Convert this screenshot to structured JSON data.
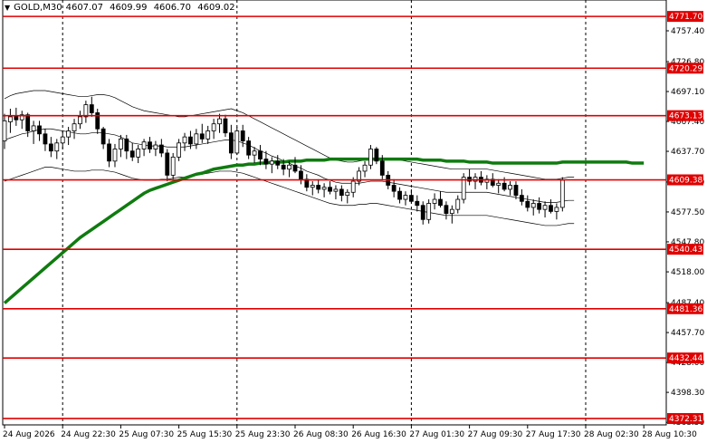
{
  "header": {
    "symbol": "GOLD,M30",
    "open": "4607.07",
    "high": "4609.99",
    "low": "4606.70",
    "close": "4609.02"
  },
  "chart_data": {
    "type": "candlestick",
    "title": "GOLD,M30",
    "ylim": [
      4366.0,
      4788.0
    ],
    "y_ticks": [
      4757.4,
      4726.8,
      4697.1,
      4667.4,
      4637.7,
      4607.2,
      4577.5,
      4547.8,
      4518.0,
      4487.4,
      4457.7,
      4428.0,
      4398.3,
      4368.5
    ],
    "x_ticks": [
      {
        "label": "24 Aug 2026",
        "slot": 0
      },
      {
        "label": "24 Aug 22:30",
        "slot": 10
      },
      {
        "label": "25 Aug 07:30",
        "slot": 20
      },
      {
        "label": "25 Aug 15:30",
        "slot": 30
      },
      {
        "label": "25 Aug 23:30",
        "slot": 40
      },
      {
        "label": "26 Aug 08:30",
        "slot": 50
      },
      {
        "label": "26 Aug 16:30",
        "slot": 60
      },
      {
        "label": "27 Aug 01:30",
        "slot": 70
      },
      {
        "label": "27 Aug 09:30",
        "slot": 80
      },
      {
        "label": "27 Aug 17:30",
        "slot": 90
      },
      {
        "label": "28 Aug 02:30",
        "slot": 100
      },
      {
        "label": "28 Aug 10:30",
        "slot": 110
      }
    ],
    "vlines_slots": [
      10,
      40,
      70,
      100
    ],
    "levels": [
      {
        "value": 4771.7,
        "label": "4771.70"
      },
      {
        "value": 4720.29,
        "label": "4720.29"
      },
      {
        "value": 4673.13,
        "label": "4673.13"
      },
      {
        "value": 4609.38,
        "label": "4609.38"
      },
      {
        "value": 4540.43,
        "label": "4540.43"
      },
      {
        "value": 4481.36,
        "label": "4481.36"
      },
      {
        "value": 4432.44,
        "label": "4432.44"
      },
      {
        "value": 4372.31,
        "label": "4372.31"
      }
    ],
    "candles": [
      [
        4648,
        4675,
        4640,
        4668
      ],
      [
        4667,
        4680,
        4656,
        4672
      ],
      [
        4672,
        4681,
        4663,
        4669
      ],
      [
        4669,
        4678,
        4660,
        4674
      ],
      [
        4674,
        4676,
        4652,
        4658
      ],
      [
        4658,
        4668,
        4645,
        4663
      ],
      [
        4663,
        4668,
        4648,
        4655
      ],
      [
        4655,
        4660,
        4638,
        4645
      ],
      [
        4645,
        4652,
        4632,
        4638
      ],
      [
        4638,
        4650,
        4630,
        4646
      ],
      [
        4646,
        4658,
        4640,
        4652
      ],
      [
        4652,
        4662,
        4644,
        4658
      ],
      [
        4658,
        4670,
        4650,
        4665
      ],
      [
        4665,
        4678,
        4660,
        4672
      ],
      [
        4672,
        4688,
        4666,
        4684
      ],
      [
        4684,
        4692,
        4672,
        4676
      ],
      [
        4676,
        4680,
        4655,
        4660
      ],
      [
        4660,
        4662,
        4640,
        4645
      ],
      [
        4645,
        4650,
        4622,
        4628
      ],
      [
        4628,
        4645,
        4622,
        4640
      ],
      [
        4640,
        4654,
        4632,
        4650
      ],
      [
        4650,
        4654,
        4630,
        4638
      ],
      [
        4638,
        4646,
        4628,
        4632
      ],
      [
        4632,
        4644,
        4626,
        4640
      ],
      [
        4640,
        4650,
        4633,
        4647
      ],
      [
        4647,
        4652,
        4636,
        4640
      ],
      [
        4640,
        4648,
        4633,
        4644
      ],
      [
        4644,
        4650,
        4632,
        4636
      ],
      [
        4636,
        4640,
        4608,
        4614
      ],
      [
        4614,
        4636,
        4610,
        4632
      ],
      [
        4632,
        4650,
        4628,
        4646
      ],
      [
        4646,
        4656,
        4638,
        4652
      ],
      [
        4652,
        4658,
        4640,
        4645
      ],
      [
        4645,
        4660,
        4640,
        4655
      ],
      [
        4655,
        4665,
        4646,
        4650
      ],
      [
        4650,
        4663,
        4645,
        4658
      ],
      [
        4658,
        4670,
        4650,
        4665
      ],
      [
        4665,
        4675,
        4656,
        4670
      ],
      [
        4670,
        4674,
        4652,
        4656
      ],
      [
        4656,
        4664,
        4630,
        4636
      ],
      [
        4636,
        4662,
        4634,
        4658
      ],
      [
        4658,
        4664,
        4642,
        4648
      ],
      [
        4648,
        4652,
        4630,
        4634
      ],
      [
        4634,
        4642,
        4626,
        4638
      ],
      [
        4638,
        4644,
        4624,
        4630
      ],
      [
        4630,
        4638,
        4620,
        4625
      ],
      [
        4625,
        4632,
        4616,
        4628
      ],
      [
        4628,
        4634,
        4620,
        4624
      ],
      [
        4624,
        4630,
        4614,
        4620
      ],
      [
        4620,
        4628,
        4612,
        4624
      ],
      [
        4624,
        4632,
        4616,
        4618
      ],
      [
        4618,
        4624,
        4605,
        4610
      ],
      [
        4610,
        4615,
        4598,
        4602
      ],
      [
        4602,
        4608,
        4594,
        4604
      ],
      [
        4604,
        4610,
        4596,
        4600
      ],
      [
        4600,
        4606,
        4592,
        4602
      ],
      [
        4602,
        4608,
        4595,
        4598
      ],
      [
        4598,
        4604,
        4590,
        4600
      ],
      [
        4600,
        4604,
        4588,
        4594
      ],
      [
        4594,
        4600,
        4586,
        4597
      ],
      [
        4597,
        4612,
        4592,
        4608
      ],
      [
        4608,
        4622,
        4604,
        4618
      ],
      [
        4618,
        4628,
        4612,
        4624
      ],
      [
        4624,
        4644,
        4620,
        4640
      ],
      [
        4640,
        4642,
        4625,
        4628
      ],
      [
        4628,
        4634,
        4610,
        4614
      ],
      [
        4614,
        4618,
        4600,
        4604
      ],
      [
        4604,
        4610,
        4592,
        4598
      ],
      [
        4598,
        4602,
        4586,
        4590
      ],
      [
        4590,
        4598,
        4584,
        4594
      ],
      [
        4594,
        4600,
        4586,
        4588
      ],
      [
        4588,
        4594,
        4578,
        4584
      ],
      [
        4584,
        4588,
        4565,
        4570
      ],
      [
        4570,
        4590,
        4566,
        4586
      ],
      [
        4586,
        4596,
        4580,
        4590
      ],
      [
        4590,
        4598,
        4582,
        4584
      ],
      [
        4584,
        4588,
        4570,
        4576
      ],
      [
        4576,
        4584,
        4566,
        4580
      ],
      [
        4580,
        4594,
        4576,
        4590
      ],
      [
        4590,
        4616,
        4586,
        4612
      ],
      [
        4612,
        4620,
        4604,
        4608
      ],
      [
        4608,
        4616,
        4600,
        4612
      ],
      [
        4612,
        4618,
        4604,
        4607
      ],
      [
        4607,
        4614,
        4600,
        4610
      ],
      [
        4610,
        4616,
        4602,
        4604
      ],
      [
        4604,
        4610,
        4596,
        4606
      ],
      [
        4606,
        4612,
        4598,
        4600
      ],
      [
        4600,
        4608,
        4594,
        4604
      ],
      [
        4604,
        4608,
        4590,
        4594
      ],
      [
        4594,
        4600,
        4584,
        4588
      ],
      [
        4588,
        4594,
        4578,
        4582
      ],
      [
        4582,
        4590,
        4574,
        4586
      ],
      [
        4586,
        4592,
        4576,
        4580
      ],
      [
        4580,
        4588,
        4572,
        4584
      ],
      [
        4584,
        4590,
        4576,
        4578
      ],
      [
        4578,
        4586,
        4570,
        4582
      ],
      [
        4582,
        4612,
        4578,
        4609
      ]
    ],
    "ma": [
      4487,
      4492,
      4497,
      4502,
      4507,
      4512,
      4517,
      4522,
      4527,
      4532,
      4537,
      4542,
      4547,
      4552,
      4556,
      4560,
      4564,
      4568,
      4572,
      4576,
      4580,
      4584,
      4588,
      4592,
      4596,
      4599,
      4601,
      4603,
      4605,
      4607,
      4609,
      4611,
      4613,
      4615,
      4616,
      4618,
      4620,
      4621,
      4622,
      4623,
      4624,
      4624,
      4625,
      4625,
      4626,
      4626,
      4627,
      4627,
      4627,
      4628,
      4628,
      4628,
      4629,
      4629,
      4629,
      4629,
      4630,
      4630,
      4630,
      4630,
      4630,
      4630,
      4630,
      4630,
      4630,
      4630,
      4630,
      4630,
      4630,
      4630,
      4630,
      4630,
      4629,
      4629,
      4629,
      4629,
      4628,
      4628,
      4628,
      4628,
      4627,
      4627,
      4627,
      4627,
      4626,
      4626,
      4626,
      4626,
      4626,
      4626,
      4626,
      4626,
      4626,
      4626,
      4626,
      4626,
      4627,
      4627,
      4627,
      4627,
      4627,
      4627,
      4627,
      4627,
      4627,
      4627,
      4627,
      4627,
      4626,
      4626,
      4626
    ],
    "bb_upper": [
      4690,
      4693,
      4695,
      4696,
      4697,
      4698,
      4698,
      4698,
      4697,
      4696,
      4695,
      4694,
      4693,
      4692,
      4692,
      4693,
      4694,
      4694,
      4693,
      4691,
      4688,
      4685,
      4682,
      4680,
      4678,
      4677,
      4676,
      4675,
      4674,
      4673,
      4672,
      4672,
      4673,
      4674,
      4675,
      4676,
      4677,
      4678,
      4679,
      4680,
      4678,
      4676,
      4673,
      4670,
      4667,
      4664,
      4661,
      4658,
      4655,
      4652,
      4649,
      4646,
      4643,
      4640,
      4637,
      4634,
      4631,
      4629,
      4628,
      4627,
      4627,
      4628,
      4629,
      4630,
      4631,
      4631,
      4631,
      4630,
      4629,
      4628,
      4627,
      4626,
      4625,
      4624,
      4623,
      4622,
      4621,
      4620,
      4620,
      4620,
      4620,
      4620,
      4620,
      4620,
      4619,
      4618,
      4617,
      4616,
      4615,
      4614,
      4613,
      4612,
      4611,
      4610,
      4610,
      4610,
      4611,
      4612,
      4612
    ],
    "bb_lower": [
      4608,
      4610,
      4612,
      4614,
      4616,
      4618,
      4620,
      4622,
      4622,
      4621,
      4620,
      4619,
      4618,
      4618,
      4618,
      4619,
      4619,
      4619,
      4618,
      4617,
      4615,
      4613,
      4611,
      4610,
      4609,
      4609,
      4609,
      4610,
      4610,
      4611,
      4612,
      4612,
      4613,
      4614,
      4615,
      4616,
      4617,
      4618,
      4618,
      4618,
      4617,
      4616,
      4614,
      4612,
      4610,
      4608,
      4606,
      4604,
      4602,
      4600,
      4598,
      4596,
      4594,
      4592,
      4590,
      4588,
      4586,
      4585,
      4584,
      4584,
      4584,
      4585,
      4585,
      4586,
      4586,
      4585,
      4584,
      4583,
      4582,
      4581,
      4580,
      4579,
      4578,
      4577,
      4576,
      4575,
      4574,
      4574,
      4574,
      4574,
      4574,
      4574,
      4574,
      4574,
      4573,
      4572,
      4571,
      4570,
      4569,
      4568,
      4567,
      4566,
      4565,
      4564,
      4564,
      4564,
      4565,
      4566,
      4566
    ],
    "bb_middle": [
      4649,
      4651,
      4653,
      4655,
      4656,
      4658,
      4659,
      4660,
      4660,
      4659,
      4658,
      4657,
      4656,
      4655,
      4655,
      4656,
      4656,
      4656,
      4655,
      4654,
      4652,
      4649,
      4646,
      4645,
      4644,
      4643,
      4643,
      4643,
      4642,
      4642,
      4642,
      4642,
      4643,
      4644,
      4645,
      4646,
      4647,
      4648,
      4649,
      4649,
      4648,
      4646,
      4644,
      4641,
      4638,
      4636,
      4633,
      4631,
      4628,
      4626,
      4623,
      4621,
      4618,
      4616,
      4614,
      4611,
      4609,
      4607,
      4606,
      4606,
      4606,
      4606,
      4607,
      4608,
      4608,
      4608,
      4607,
      4606,
      4605,
      4604,
      4603,
      4602,
      4601,
      4600,
      4599,
      4598,
      4597,
      4597,
      4597,
      4597,
      4597,
      4597,
      4597,
      4597,
      4596,
      4595,
      4594,
      4593,
      4592,
      4591,
      4590,
      4589,
      4588,
      4587,
      4587,
      4587,
      4588,
      4589,
      4589
    ]
  }
}
